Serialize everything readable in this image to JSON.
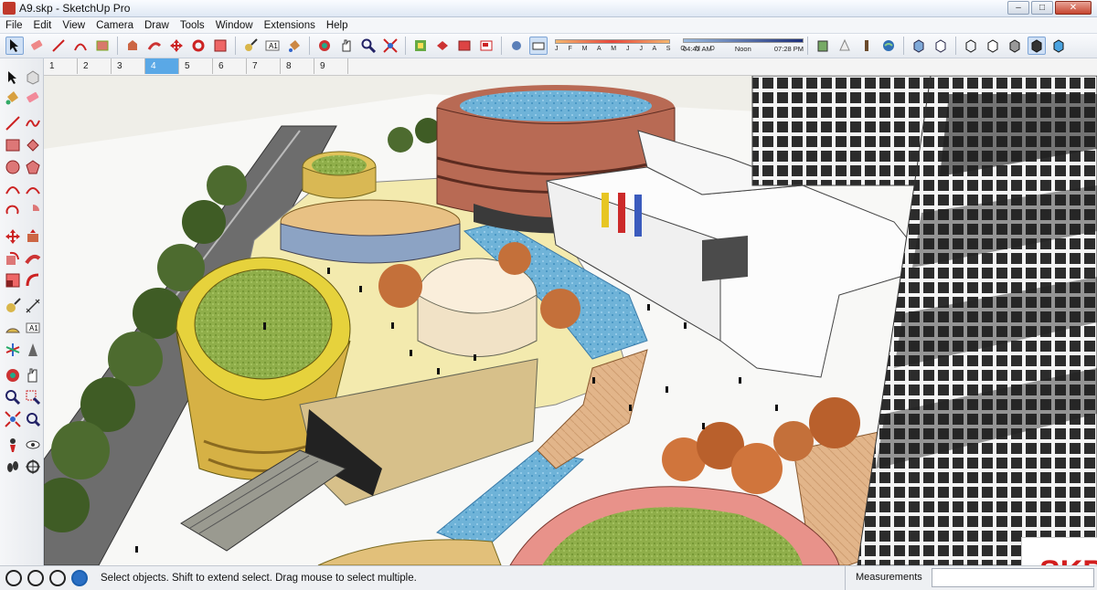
{
  "window": {
    "title": "A9.skp - SketchUp Pro"
  },
  "menu": [
    "File",
    "Edit",
    "View",
    "Camera",
    "Draw",
    "Tools",
    "Window",
    "Extensions",
    "Help"
  ],
  "shadow_settings": {
    "months": "J F M A M J J A S O N D",
    "time_start": "04:42 AM",
    "time_mid": "Noon",
    "time_end": "07:28 PM"
  },
  "scene_tabs": [
    "1",
    "2",
    "3",
    "4",
    "5",
    "6",
    "7",
    "8",
    "9"
  ],
  "active_scene": "4",
  "status": {
    "message": "Select objects. Shift to extend select. Drag mouse to select multiple.",
    "measurements_label": "Measurements",
    "measurements_value": ""
  },
  "watermark": "SKP",
  "colors": {
    "accent": "#5aa8e6",
    "brand_red": "#d21e1e"
  }
}
